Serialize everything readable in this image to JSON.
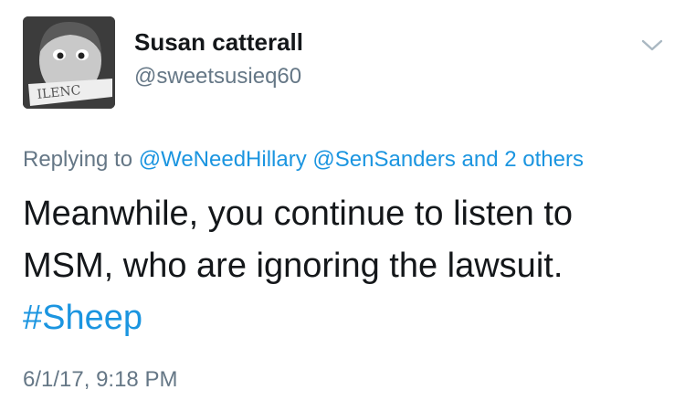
{
  "user": {
    "display_name": "Susan catterall",
    "handle": "@sweetsusieq60",
    "avatar_icon": "silenced-child-avatar",
    "avatar_overlay_text": "ILENC"
  },
  "reply": {
    "prefix": "Replying to",
    "mention1": "@WeNeedHillary",
    "mention2": "@SenSanders",
    "others": "and 2 others"
  },
  "tweet": {
    "line1": "Meanwhile, you continue to listen to",
    "line2": "MSM, who are ignoring the lawsuit.",
    "hashtag": "#Sheep"
  },
  "timestamp": "6/1/17, 9:18 PM",
  "colors": {
    "text": "#14171a",
    "secondary": "#657786",
    "link": "#1b95e0",
    "chevron": "#aab8c2"
  },
  "icons": {
    "menu": "chevron-down-icon"
  }
}
